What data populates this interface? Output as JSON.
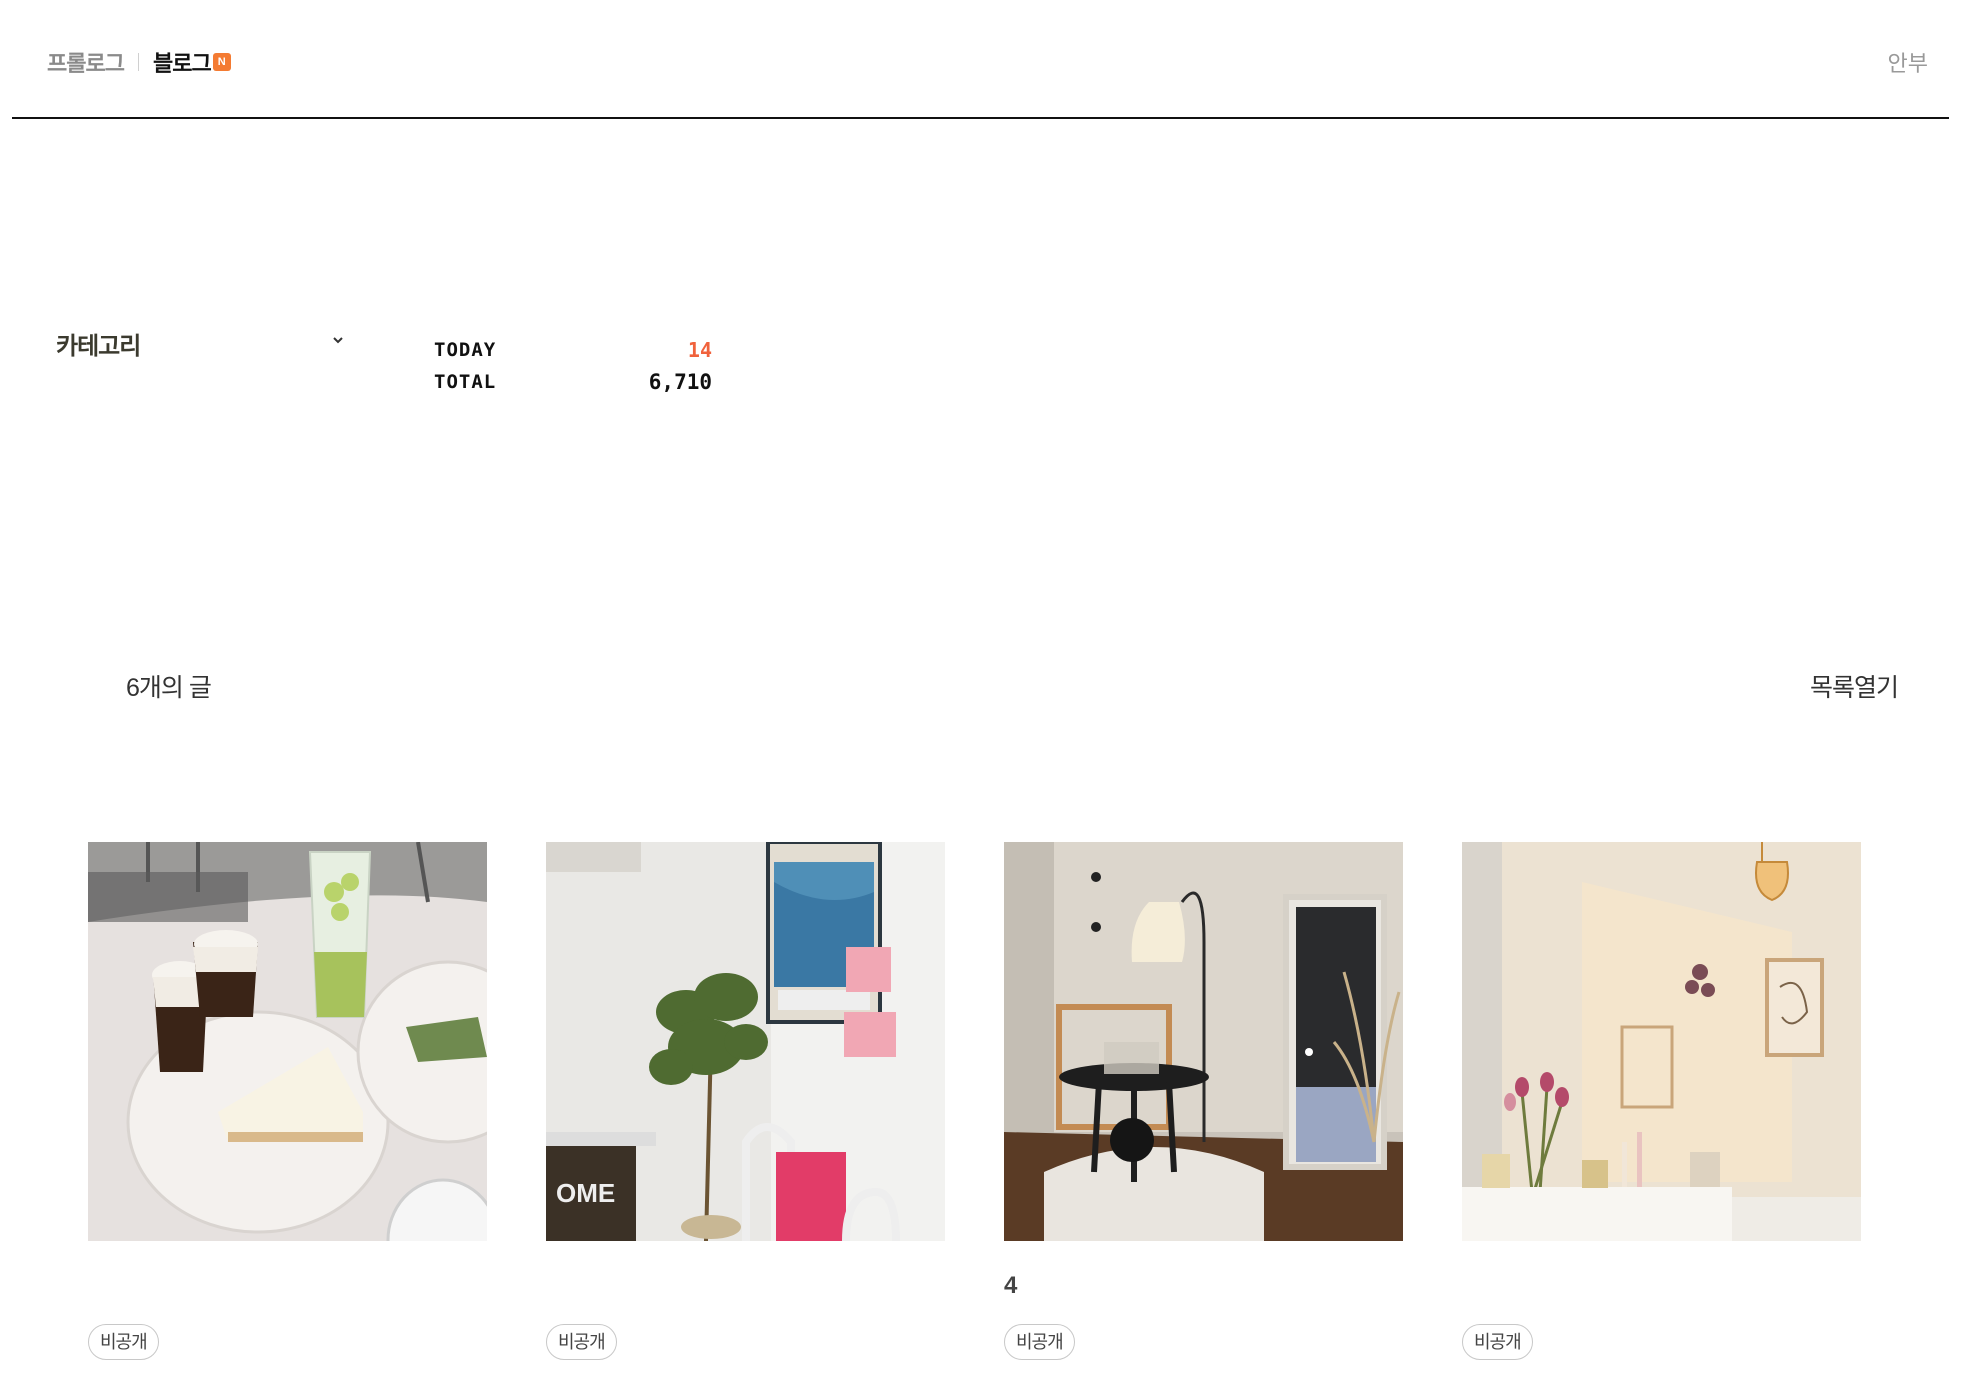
{
  "header": {
    "prologue_label": "프롤로그",
    "blog_label": "블로그",
    "new_badge": "N",
    "neighbor_label": "안부"
  },
  "sidebar": {
    "category_label": "카테고리",
    "category_icon": "chevron-down-icon"
  },
  "counter": {
    "today_label": "TODAY",
    "today_value": "14",
    "total_label": "TOTAL",
    "total_value": "6,710",
    "today_color": "#f0623c"
  },
  "list": {
    "count_label": "6개의 글",
    "open_label": "목록열기"
  },
  "posts": [
    {
      "title": "",
      "badge": "비공개",
      "thumb": "cafe-cheesecake-photo"
    },
    {
      "title": "",
      "badge": "비공개",
      "thumb": "plant-poster-corner-photo"
    },
    {
      "title": "4",
      "badge": "비공개",
      "thumb": "lamp-mirror-room-photo"
    },
    {
      "title": "",
      "badge": "비공개",
      "thumb": "sunlit-flowers-wall-photo"
    }
  ],
  "colors": {
    "accent_orange": "#f47b32",
    "divider": "#111111"
  }
}
